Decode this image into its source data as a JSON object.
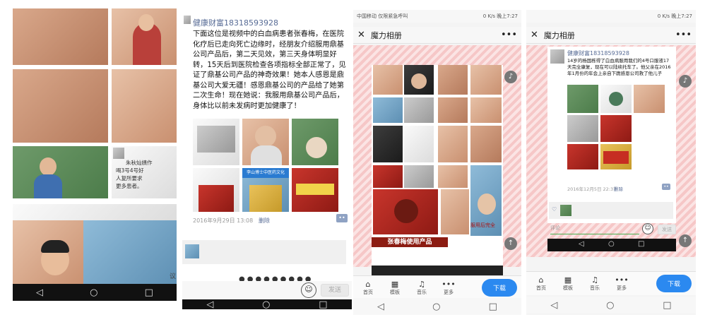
{
  "panel2": {
    "author": "健康财富18318593928",
    "post_text": "下面这位是视频中的白血病患者张春梅，在医院化疗后已走向死亡边缘时，经朋友介绍服用鼎基公司产品后，第二天见效，第三天身体明显好转，15天后到医院检查各项指标全部正常了，见证了鼎基公司产品的神奇效果！她本人感恩是鼎基公司大爱无疆！感恩鼎基公司的产品给了她第二次生命！现在她说：我服用鼎基公司产品后，身体比以前未发病时更加健康了！",
    "timestamp": "2016年9月29日 13:08",
    "delete_label": "删除",
    "send_label": "发送",
    "banner_text": "李山博士中医药文化",
    "nav_icons": [
      "◁",
      "○",
      "□"
    ]
  },
  "panel1": {
    "snippet_name": "朱秋灿姨作",
    "snippet_line1": "喝3号4号好",
    "snippet_line2": "人复所要求",
    "snippet_line3": "更多患者。",
    "bottom_label": "议"
  },
  "panel3": {
    "status_left": "中国移动 仅限紧急呼叫",
    "status_right": "0 K/s  晚上7:27",
    "title": "魔力相册",
    "caption_red": "张春梅使用产品",
    "caption_right": "服用后完全",
    "tabs": [
      {
        "icon": "⌂",
        "label": "首页"
      },
      {
        "icon": "▦",
        "label": "模板"
      },
      {
        "icon": "♫",
        "label": "音乐"
      },
      {
        "icon": "•••",
        "label": "更多"
      }
    ],
    "download_label": "下载",
    "nav_icons": [
      "◁",
      "○",
      "□"
    ]
  },
  "panel4": {
    "status_right": "0 K/s  晚上7:27",
    "title": "魔力相册",
    "author": "健康财富18318593928",
    "post_text": "14岁的杨国栋得了白血病服用我们的4号口服液17天完全康复，现在可以陆续托车了。他父亲在2016年1月份的年会上亲自下跪感恩公司救了他儿子",
    "timestamp": "2016年12月5日 22:37",
    "delete_label": "删除",
    "comment_placeholder": "评论",
    "send_label": "发送",
    "tabs": [
      {
        "icon": "⌂",
        "label": "首页"
      },
      {
        "icon": "▦",
        "label": "模板"
      },
      {
        "icon": "♫",
        "label": "音乐"
      },
      {
        "icon": "•••",
        "label": "更多"
      }
    ],
    "download_label": "下载",
    "nav_icons": [
      "◁",
      "○",
      "□"
    ]
  },
  "colors": {
    "accent": "#2b89f0",
    "author": "#576b95"
  }
}
